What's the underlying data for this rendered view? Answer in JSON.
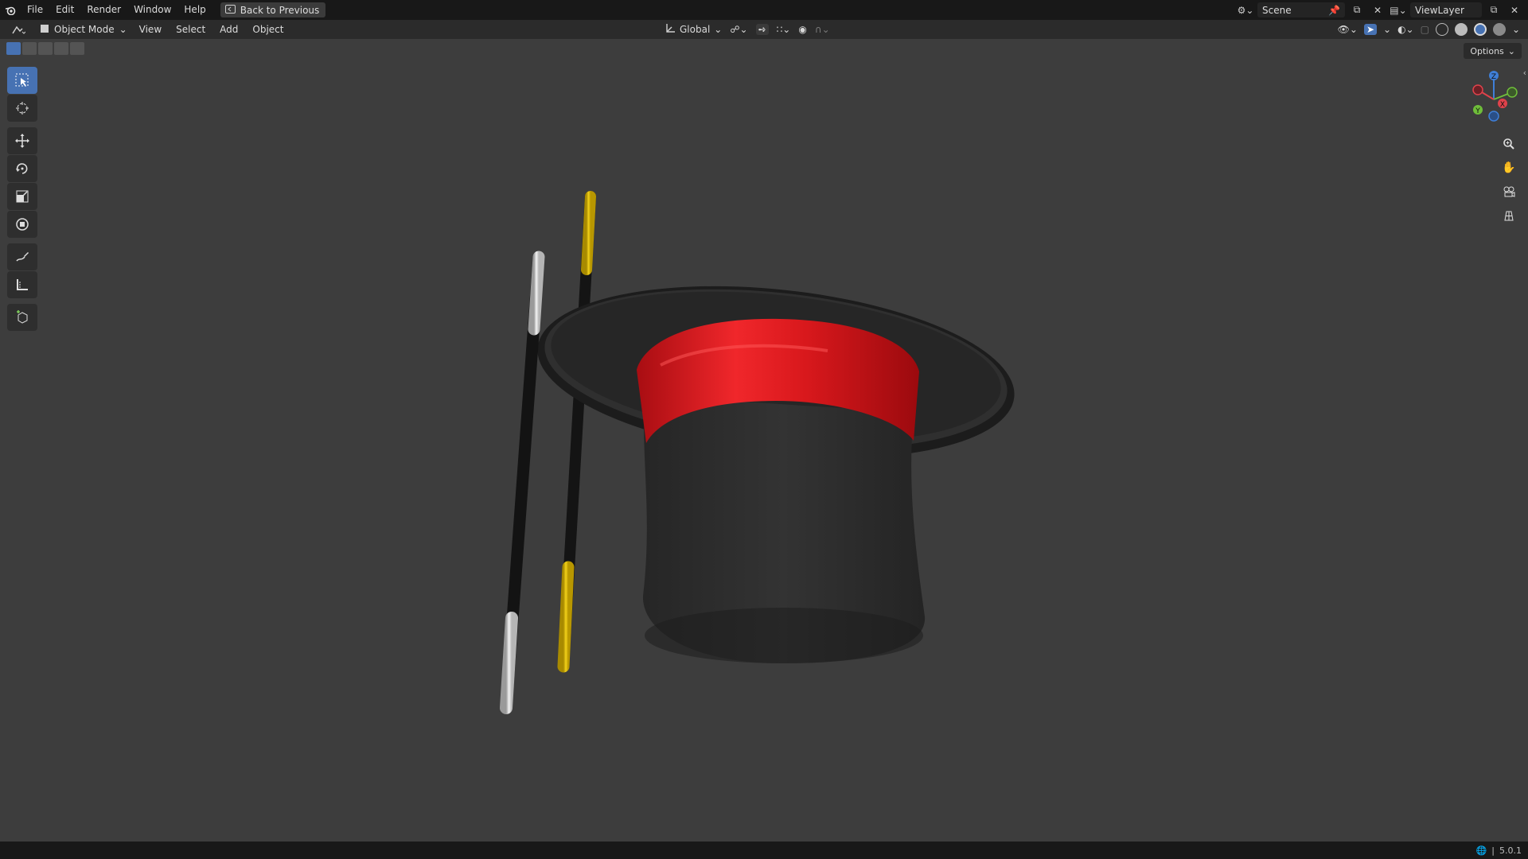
{
  "menu": {
    "items": [
      "File",
      "Edit",
      "Render",
      "Window",
      "Help"
    ],
    "back_button": "Back to Previous"
  },
  "topbar_right": {
    "scene": "Scene",
    "view_layer": "ViewLayer"
  },
  "header": {
    "mode": "Object Mode",
    "menus": [
      "View",
      "Select",
      "Add",
      "Object"
    ],
    "transform_orientation": "Global"
  },
  "viewport": {
    "options_label": "Options",
    "gizmo_axes": [
      "Z",
      "Y",
      "X"
    ],
    "tools": [
      "select-box",
      "cursor",
      "move",
      "rotate",
      "scale",
      "transform",
      "annotate",
      "measure",
      "add-cube"
    ]
  },
  "status": {
    "version": "5.0.1"
  },
  "colors": {
    "accent": "#4772b3",
    "axis_x": "#e0424b",
    "axis_y": "#6fbe3a",
    "axis_z": "#3f7fd8"
  }
}
